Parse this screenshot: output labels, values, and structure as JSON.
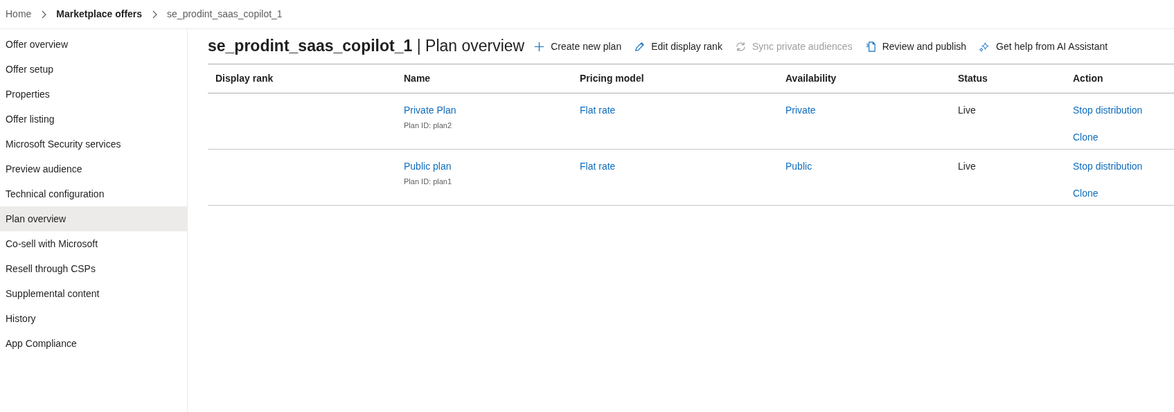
{
  "breadcrumb": [
    {
      "label": "Home",
      "emphasized": false
    },
    {
      "label": "Marketplace offers",
      "emphasized": true
    },
    {
      "label": "se_prodint_saas_copilot_1",
      "emphasized": false
    }
  ],
  "sidebar": {
    "items": [
      {
        "label": "Offer overview",
        "selected": false
      },
      {
        "label": "Offer setup",
        "selected": false
      },
      {
        "label": "Properties",
        "selected": false
      },
      {
        "label": "Offer listing",
        "selected": false
      },
      {
        "label": "Microsoft Security services",
        "selected": false
      },
      {
        "label": "Preview audience",
        "selected": false
      },
      {
        "label": "Technical configuration",
        "selected": false
      },
      {
        "label": "Plan overview",
        "selected": true
      },
      {
        "label": "Co-sell with Microsoft",
        "selected": false
      },
      {
        "label": "Resell through CSPs",
        "selected": false
      },
      {
        "label": "Supplemental content",
        "selected": false
      },
      {
        "label": "History",
        "selected": false
      },
      {
        "label": "App Compliance",
        "selected": false
      }
    ]
  },
  "page": {
    "offer_name": "se_prodint_saas_copilot_1",
    "separator": "|",
    "title": "Plan overview"
  },
  "toolbar": [
    {
      "kind": "plus",
      "label": "Create new plan",
      "disabled": false
    },
    {
      "kind": "pencil",
      "label": "Edit display rank",
      "disabled": false
    },
    {
      "kind": "sync",
      "label": "Sync private audiences",
      "disabled": true
    },
    {
      "kind": "document",
      "label": "Review and publish",
      "disabled": false
    },
    {
      "kind": "sparkle",
      "label": "Get help from AI Assistant",
      "disabled": false
    }
  ],
  "table": {
    "columns": [
      "Display rank",
      "Name",
      "Pricing model",
      "Availability",
      "Status",
      "Action"
    ],
    "rows": [
      {
        "name": "Private Plan",
        "plan_id": "Plan ID: plan2",
        "pricing_model": "Flat rate",
        "availability": "Private",
        "status": "Live",
        "actions": [
          "Stop distribution",
          "Clone"
        ]
      },
      {
        "name": "Public plan",
        "plan_id": "Plan ID: plan1",
        "pricing_model": "Flat rate",
        "availability": "Public",
        "status": "Live",
        "actions": [
          "Stop distribution",
          "Clone"
        ]
      }
    ]
  }
}
